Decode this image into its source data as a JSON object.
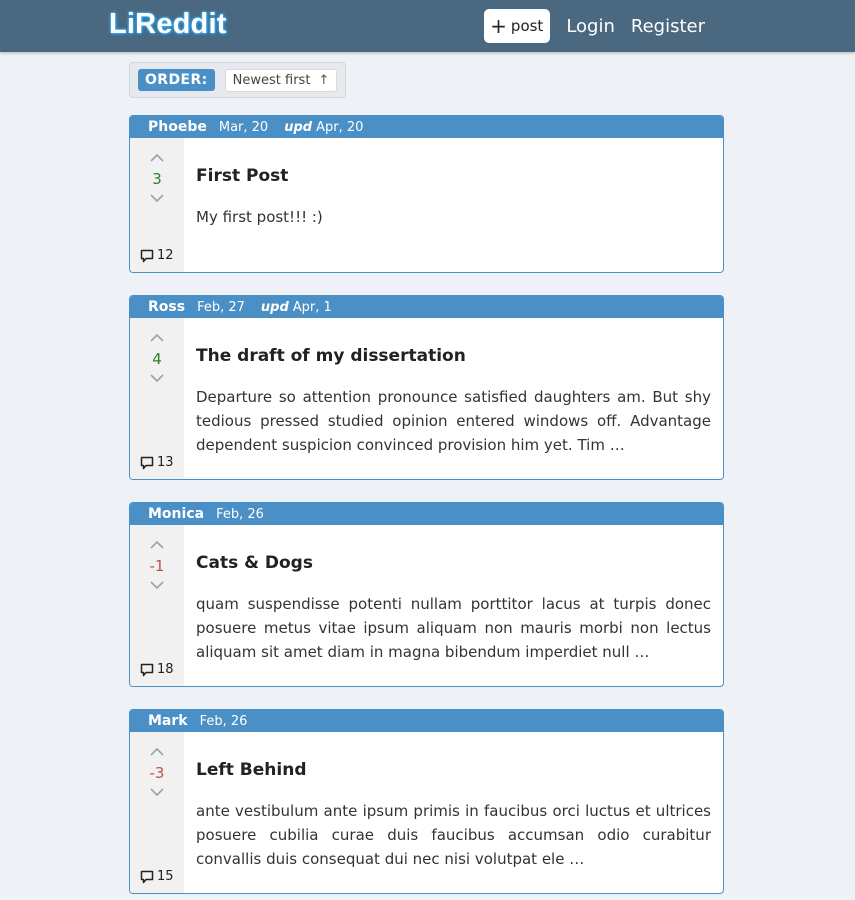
{
  "app": {
    "logo": "LiReddit"
  },
  "nav": {
    "post_plus": "+",
    "post_label": "post",
    "login": "Login",
    "register": "Register"
  },
  "order": {
    "label": "ORDER:",
    "value": "Newest first",
    "arrow": "↑"
  },
  "posts": [
    {
      "author": "Phoebe",
      "date": "Mar, 20",
      "upd_label": "upd",
      "upd_date": "Apr, 20",
      "score": "3",
      "score_type": "pos",
      "title": "First Post",
      "text": "My first post!!! :)",
      "comments": "12"
    },
    {
      "author": "Ross",
      "date": "Feb, 27",
      "upd_label": "upd",
      "upd_date": "Apr, 1",
      "score": "4",
      "score_type": "pos",
      "title": "The draft of my dissertation",
      "text": "Departure so attention pronounce satisfied daughters am. But shy tedious pressed studied opinion entered windows off. Advantage dependent suspicion convinced provision him yet. Tim …",
      "comments": "13"
    },
    {
      "author": "Monica",
      "date": "Feb, 26",
      "score": "-1",
      "score_type": "neg",
      "title": "Cats & Dogs",
      "text": "quam suspendisse potenti nullam porttitor lacus at turpis donec posuere metus vitae ipsum aliquam non mauris morbi non lectus aliquam sit amet diam in magna bibendum imperdiet null …",
      "comments": "18"
    },
    {
      "author": "Mark",
      "date": "Feb, 26",
      "score": "-3",
      "score_type": "neg",
      "title": "Left Behind",
      "text": "ante vestibulum ante ipsum primis in faucibus orci luctus et ultrices posuere cubilia curae duis faucibus accumsan odio curabitur convallis duis consequat dui nec nisi volutpat ele …",
      "comments": "15"
    }
  ],
  "icons": {
    "upvote": "chevron-up-icon",
    "downvote": "chevron-down-icon",
    "comment": "comment-icon"
  },
  "colors": {
    "navbar": "#4a6880",
    "accent": "#4a90c6",
    "positive": "#2f7d32",
    "negative": "#c0504d"
  }
}
